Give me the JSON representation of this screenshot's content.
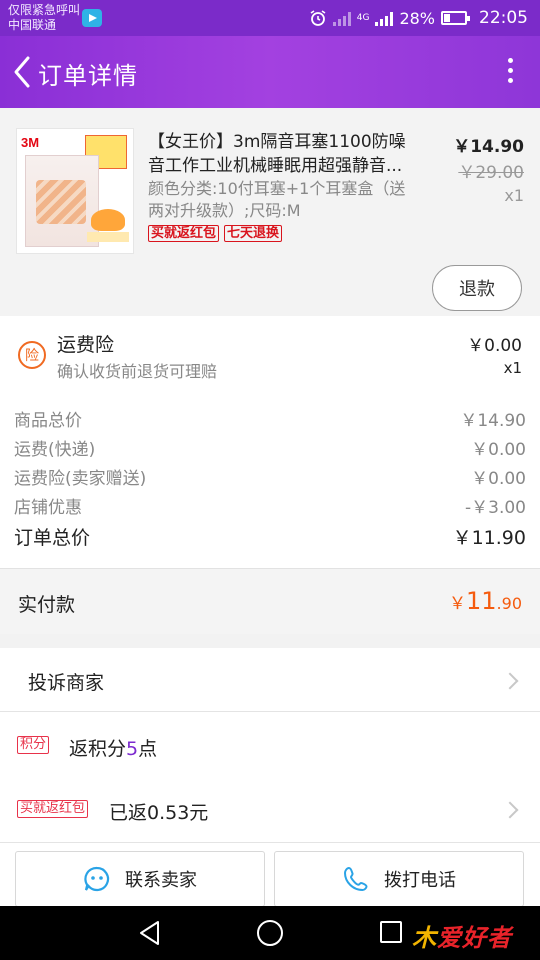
{
  "status_bar": {
    "carrier_line1": "仅限紧急呼叫",
    "carrier_line2": "中国联通",
    "network": "4G",
    "battery": "28%",
    "time": "22:05"
  },
  "header": {
    "title": "订单详情",
    "back_icon": "chevron-left-icon",
    "more_icon": "more-vertical-icon"
  },
  "product": {
    "title": "【女王价】3m隔音耳塞1100防噪音工作工业机械睡眠用超强静音...",
    "spec": "颜色分类:10付耳塞+1个耳塞盒（送两对升级款）;尺码:M",
    "tags": [
      "买就返红包",
      "七天退换"
    ],
    "price": "￥14.90",
    "original_price": "￥29.00",
    "quantity": "x1",
    "refund_label": "退款",
    "thumb_logo": "3M"
  },
  "insurance": {
    "icon_text": "险",
    "title": "运费险",
    "subtitle": "确认收货前退货可理赔",
    "price": "￥0.00",
    "quantity": "x1"
  },
  "summary": {
    "rows": [
      {
        "label": "商品总价",
        "value": "￥14.90"
      },
      {
        "label": "运费(快递)",
        "value": "￥0.00"
      },
      {
        "label": "运费险(卖家赠送)",
        "value": "￥0.00"
      },
      {
        "label": "店铺优惠",
        "value": "-￥3.00"
      }
    ],
    "total_label": "订单总价",
    "total_value": "￥11.90"
  },
  "paid": {
    "label": "实付款",
    "currency": "￥",
    "amount_int": "11",
    "amount_dec": ".90",
    "color": "#f55b0e"
  },
  "links": {
    "complain": "投诉商家",
    "points_badge": "积分",
    "points_prefix": "返积分",
    "points_value": "5",
    "points_suffix": "点",
    "redpack_badge": "买就返红包",
    "redpack_text": "已返0.53元"
  },
  "actions": {
    "contact_seller": "联系卖家",
    "call": "拨打电话"
  },
  "watermark": {
    "part1": "爱好者"
  },
  "colors": {
    "header": "#8a2fd6",
    "accent_orange": "#f55b0e",
    "tag_red": "#d9141d",
    "highlight_purple": "#7c2bcf"
  }
}
